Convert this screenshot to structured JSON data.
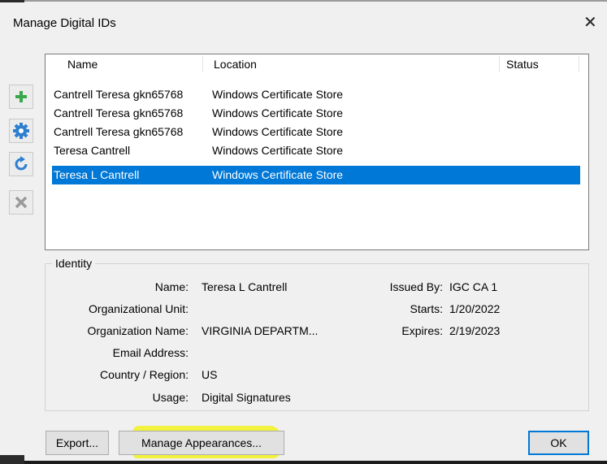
{
  "dialog": {
    "title": "Manage Digital IDs",
    "close_glyph": "✕"
  },
  "table": {
    "columns": [
      "Name",
      "Location",
      "Status"
    ],
    "rows": [
      {
        "name": "Cantrell Teresa gkn65768",
        "location": "Windows Certificate Store",
        "status": ""
      },
      {
        "name": "Cantrell Teresa gkn65768",
        "location": "Windows Certificate Store",
        "status": ""
      },
      {
        "name": "Cantrell Teresa gkn65768",
        "location": "Windows Certificate Store",
        "status": ""
      },
      {
        "name": "Teresa Cantrell",
        "location": "Windows Certificate Store",
        "status": ""
      },
      {
        "name": "Teresa L Cantrell",
        "location": "Windows Certificate Store",
        "status": ""
      }
    ],
    "selected_index": 4
  },
  "toolbar": {
    "icons": [
      "add-icon",
      "settings-gear-icon",
      "refresh-icon",
      "remove-icon"
    ],
    "colors": {
      "add": "#39a84a",
      "gear": "#2f7fd0",
      "refresh": "#2f7fd0",
      "remove_disabled": "#9a9a9a"
    }
  },
  "identity": {
    "legend": "Identity",
    "name_label": "Name:",
    "name_value": "Teresa L Cantrell",
    "org_unit_label": "Organizational Unit:",
    "org_unit_value": "",
    "org_name_label": "Organization Name:",
    "org_name_value": "VIRGINIA DEPARTM...",
    "email_label": "Email Address:",
    "email_value": "",
    "country_label": "Country / Region:",
    "country_value": "US",
    "usage_label": "Usage:",
    "usage_value": "Digital Signatures",
    "issued_by_label": "Issued By:",
    "issued_by_value": "IGC CA 1",
    "starts_label": "Starts:",
    "starts_value": "1/20/2022",
    "expires_label": "Expires:",
    "expires_value": "2/19/2023"
  },
  "buttons": {
    "export": "Export...",
    "manage_appearances": "Manage Appearances...",
    "ok": "OK"
  },
  "colors": {
    "selection": "#0078d7",
    "highlight": "#f3f23e",
    "dialog_bg": "#f0f0f0"
  }
}
